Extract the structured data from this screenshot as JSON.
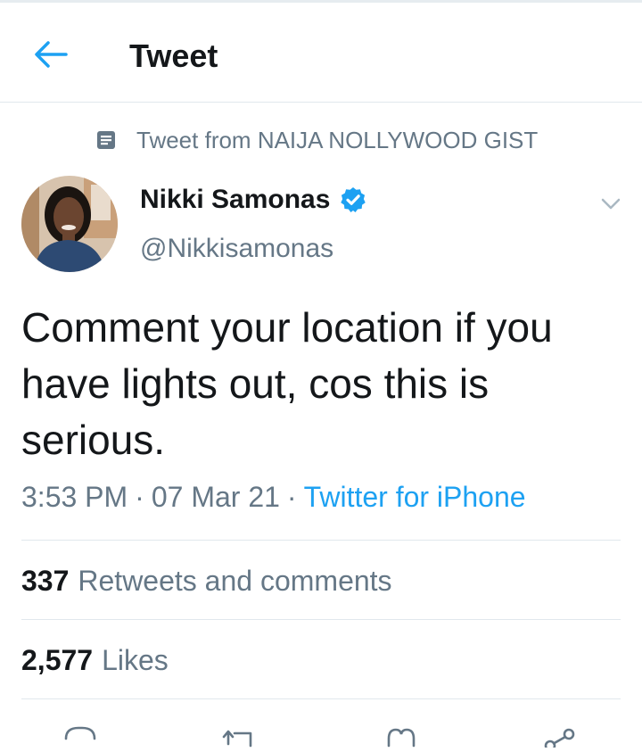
{
  "header": {
    "title": "Tweet",
    "back_icon": "arrow-left-icon"
  },
  "social_context": {
    "text": "Tweet from NAIJA NOLLYWOOD GIST",
    "icon": "document-icon"
  },
  "author": {
    "name": "Nikki Samonas",
    "handle": "@Nikkisamonas",
    "verified": true,
    "verified_icon": "verified-badge-icon"
  },
  "tweet": {
    "text": "Comment your location if you have lights out, cos this is serious.",
    "time": "3:53 PM",
    "date": "07 Mar 21",
    "separator": "·",
    "source": "Twitter for iPhone"
  },
  "stats": {
    "retweets_count": "337",
    "retweets_label": "Retweets and comments",
    "likes_count": "2,577",
    "likes_label": "Likes"
  },
  "actions": [
    "reply-icon",
    "retweet-icon",
    "like-icon",
    "share-icon"
  ],
  "colors": {
    "accent": "#1da1f2",
    "text": "#14171a",
    "secondary": "#657786",
    "divider": "#e1e8ed"
  }
}
